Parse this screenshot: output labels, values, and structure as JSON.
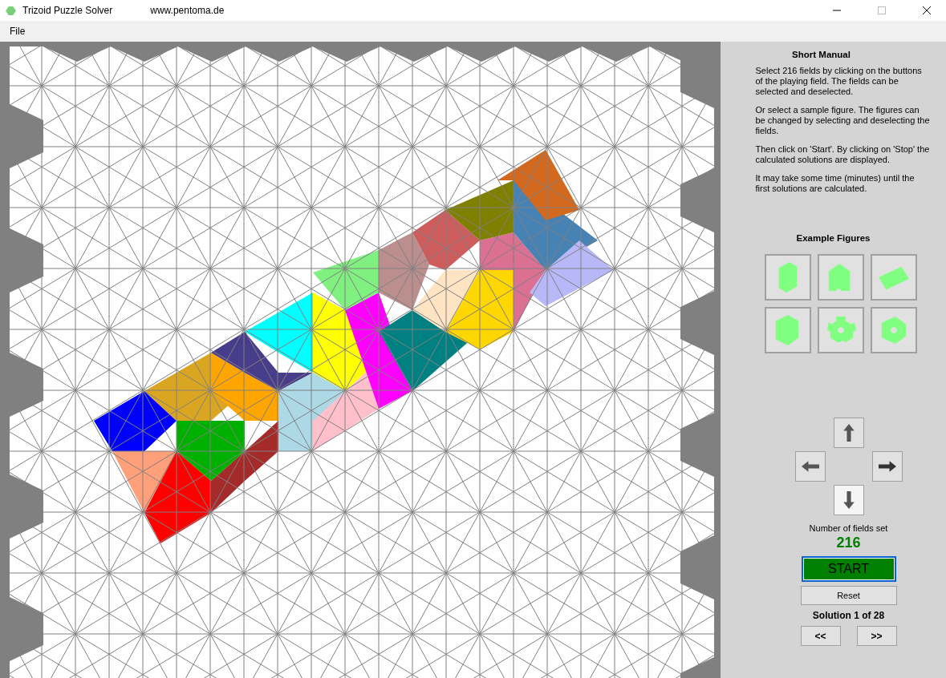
{
  "window": {
    "title": "Trizoid Puzzle Solver",
    "url": "www.pentoma.de"
  },
  "menu": [
    "File"
  ],
  "manual": {
    "title": "Short Manual",
    "paragraphs": [
      "Select 216 fields by clicking on the buttons of the playing field. The fields can be selected and deselected.",
      "Or select a sample figure. The figures can be changed by selecting and deselecting the fields.",
      "Then click on 'Start'. By clicking on 'Stop' the calculated solutions are displayed.",
      "It may take some time (minutes) until the first solutions are calculated."
    ]
  },
  "examples": {
    "title": "Example Figures"
  },
  "fields": {
    "label": "Number of fields set",
    "count": "216"
  },
  "start_button": "START",
  "reset_button": "Reset",
  "solution": "Solution 1 of 28",
  "nav_buttons": [
    "<<",
    ">>"
  ]
}
